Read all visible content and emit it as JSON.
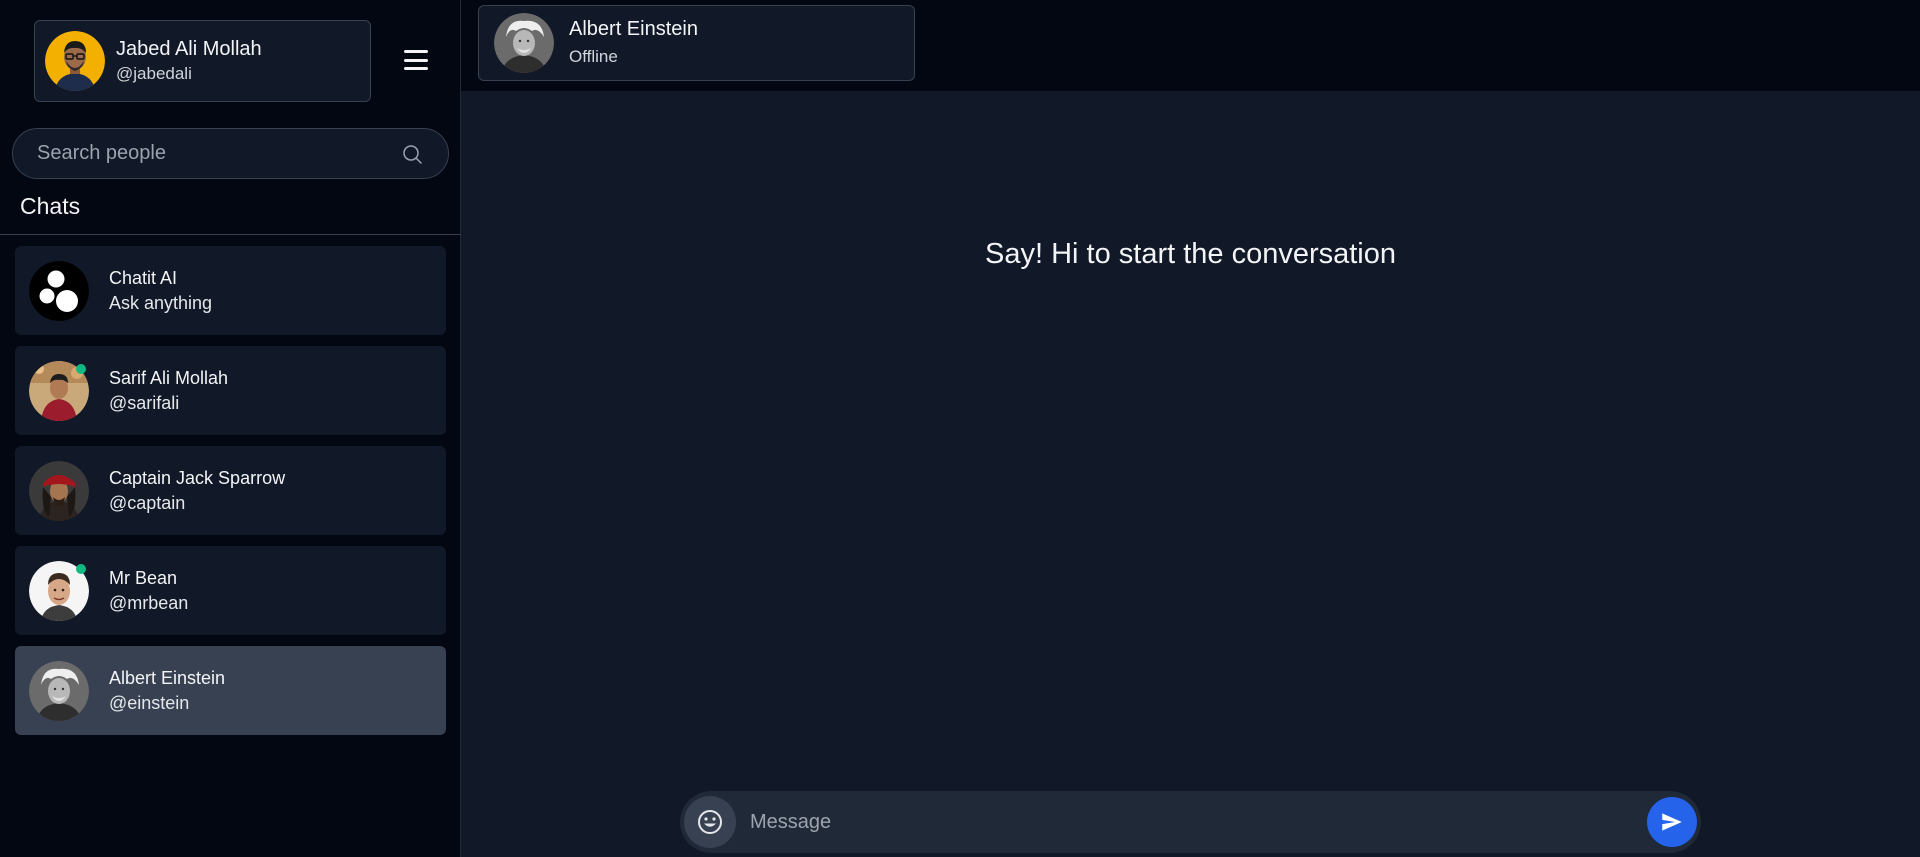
{
  "user": {
    "name": "Jabed Ali Mollah",
    "handle": "@jabedali"
  },
  "search": {
    "placeholder": "Search people"
  },
  "chats": {
    "heading": "Chats",
    "items": [
      {
        "name": "Chatit AI",
        "sub": "Ask anything",
        "avatar": "chatit-logo",
        "online": false
      },
      {
        "name": "Sarif Ali Mollah",
        "sub": "@sarifali",
        "avatar": "photo",
        "online": true
      },
      {
        "name": "Captain Jack Sparrow",
        "sub": "@captain",
        "avatar": "photo",
        "online": false
      },
      {
        "name": "Mr Bean",
        "sub": "@mrbean",
        "avatar": "photo",
        "online": true
      },
      {
        "name": "Albert Einstein",
        "sub": "@einstein",
        "avatar": "photo",
        "online": false,
        "active": true
      }
    ]
  },
  "contact": {
    "name": "Albert Einstein",
    "status": "Offline"
  },
  "conversation": {
    "empty_text": "Say! Hi to start the conversation"
  },
  "composer": {
    "placeholder": "Message"
  },
  "colors": {
    "sidebar_bg": "#030712",
    "panel_bg": "#111827",
    "active_item": "#374151",
    "online": "#10b981",
    "send": "#2563eb"
  }
}
